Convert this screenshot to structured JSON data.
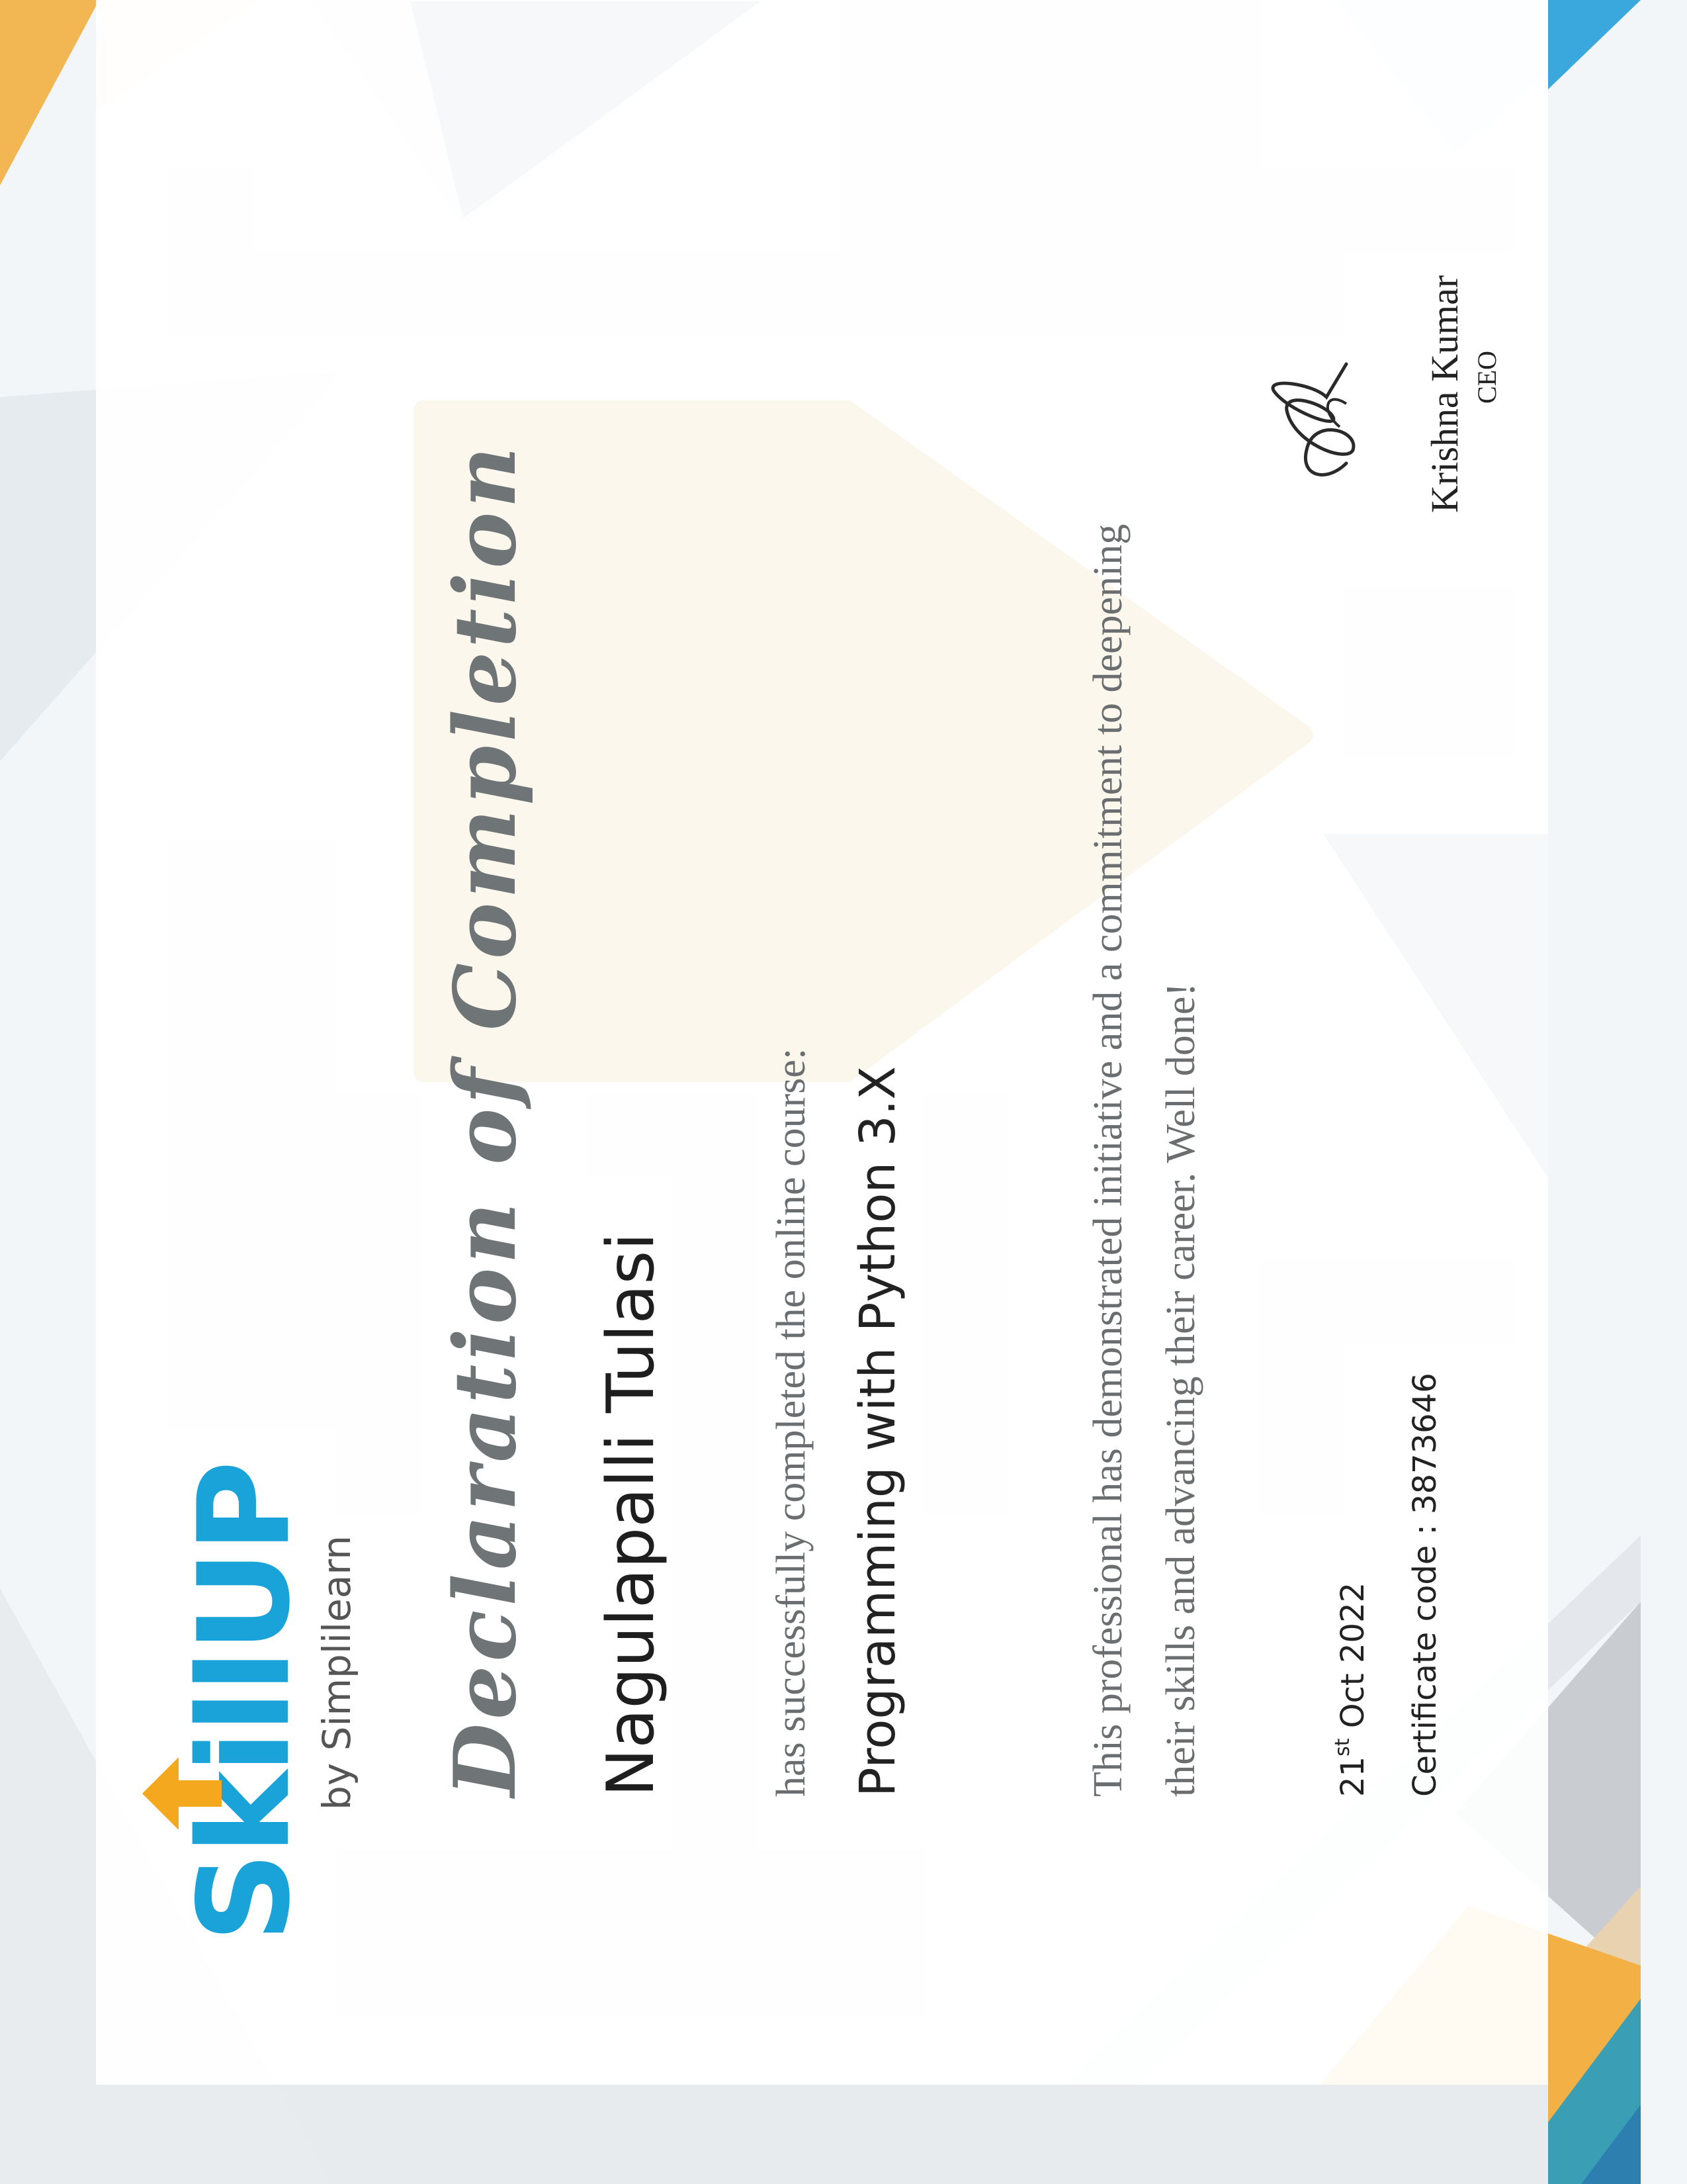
{
  "brand": {
    "logo_text": "SkillUP",
    "byline": "by Simplilearn",
    "primary_color": "#1aa3d9",
    "accent_color": "#f4a81d"
  },
  "certificate": {
    "title": "Declaration of Completion",
    "recipient": "Nagulapalli Tulasi",
    "completed_text": "has successfully completed the online course:",
    "course": "Programming with Python 3.X",
    "description_line1": "This professional has demonstrated initiative and a commitment to deepening",
    "description_line2": "their skills and advancing their career. Well done!",
    "date_day": "21",
    "date_suffix": "st",
    "date_rest": " Oct 2022",
    "certificate_code": "Certificate code : 3873646"
  },
  "signatory": {
    "name": "Krishna Kumar",
    "role": "CEO"
  }
}
